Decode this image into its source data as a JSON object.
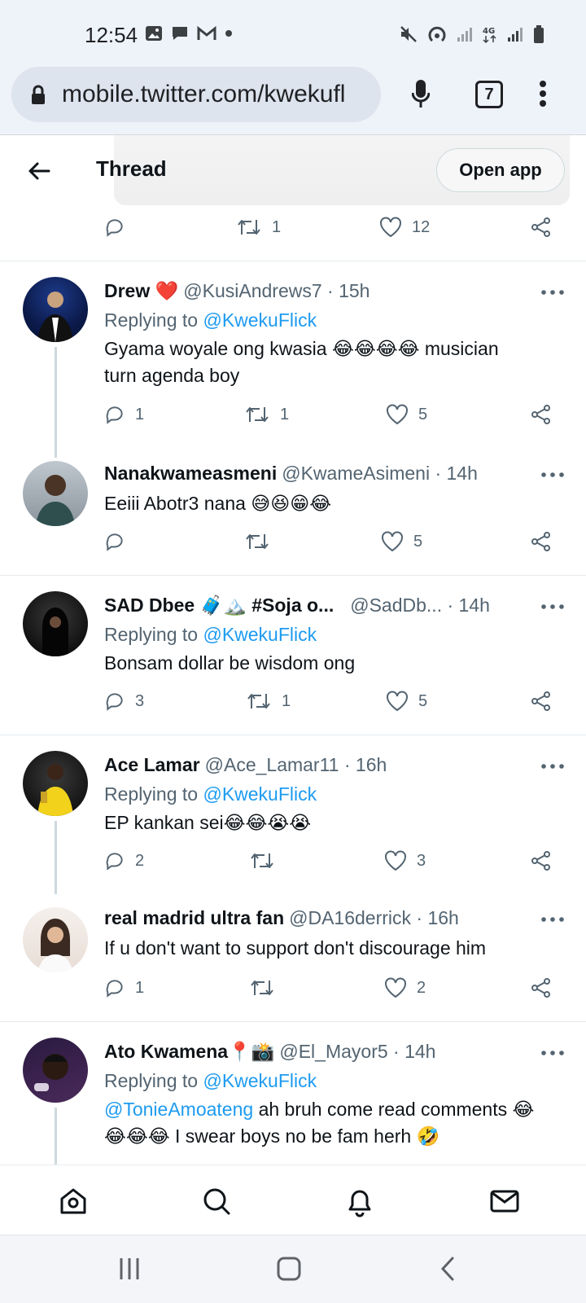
{
  "status_bar": {
    "time": "12:54"
  },
  "browser": {
    "url": "mobile.twitter.com/kwekufl",
    "tab_count": "7"
  },
  "header": {
    "title": "Thread",
    "open_app_label": "Open app"
  },
  "top_actions": {
    "retweets": "1",
    "likes": "12"
  },
  "tweets": [
    {
      "name": "Drew ❤️",
      "meta": "@KusiAndrews7 · 15h",
      "replying_prefix": "Replying to ",
      "replying_to": "@KwekuFlick",
      "body_line1": "Gyama woyale ong kwasia 😂😂😂😂 musician",
      "body_line2": "turn agenda boy",
      "replies": "1",
      "retweets": "1",
      "likes": "5"
    },
    {
      "name": "Nanakwameasmeni",
      "meta": "@KwameAsimeni · 14h",
      "body_line1": "Eeiii Abotr3 nana 😅😆😁😂",
      "replies": "",
      "retweets": "",
      "likes": "5"
    },
    {
      "name": "SAD Dbee 🧳🏔️ #Soja o...",
      "meta": "@SadDb... · 14h",
      "replying_prefix": "Replying to ",
      "replying_to": "@KwekuFlick",
      "body_line1": "Bonsam dollar be wisdom ong",
      "replies": "3",
      "retweets": "1",
      "likes": "5"
    },
    {
      "name": "Ace Lamar",
      "meta": "@Ace_Lamar11 · 16h",
      "replying_prefix": "Replying to ",
      "replying_to": "@KwekuFlick",
      "body_line1": "EP kankan sei😂😂😭😭",
      "replies": "2",
      "retweets": "",
      "likes": "3"
    },
    {
      "name": "real madrid ultra fan",
      "meta": "@DA16derrick · 16h",
      "body_line1": "If u don't want to support don't discourage him",
      "replies": "1",
      "retweets": "",
      "likes": "2"
    },
    {
      "name": "Ato Kwamena📍📸",
      "meta": "@El_Mayor5 · 14h",
      "replying_prefix": "Replying to ",
      "replying_to": "@KwekuFlick",
      "body_mention": "@TonieAmoateng",
      "body_line1": " ah bruh come read comments 😂",
      "body_line2": "😂😂😂 I swear boys no be fam herh 🤣"
    }
  ]
}
